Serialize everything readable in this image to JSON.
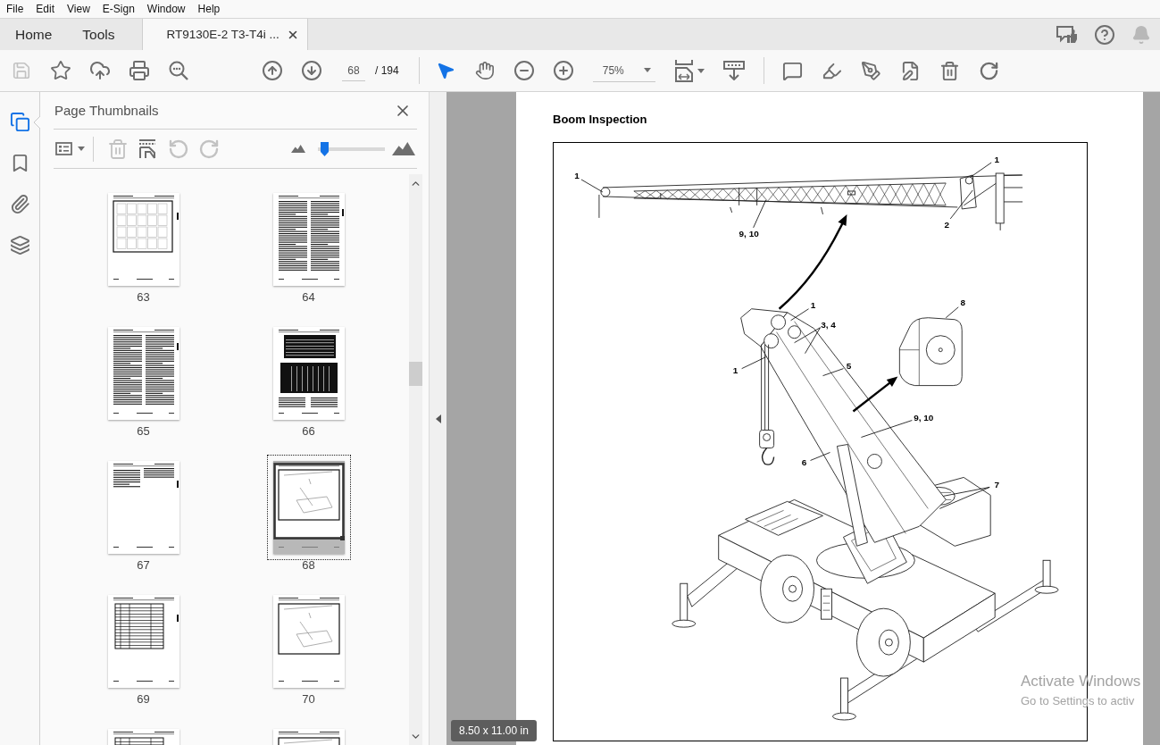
{
  "menu_bar": {
    "items": [
      "File",
      "Edit",
      "View",
      "E-Sign",
      "Window",
      "Help"
    ]
  },
  "tabs": [
    {
      "label": "Home",
      "kind": "home",
      "selected": false
    },
    {
      "label": "Tools",
      "kind": "tools",
      "selected": false
    },
    {
      "label": "RT9130E-2 T3-T4i ...",
      "kind": "document",
      "selected": true
    }
  ],
  "toolbar": {
    "save": {
      "disabled": true
    },
    "page_number": "68",
    "page_count": "/ 194",
    "tools": [
      {
        "kind": "select",
        "selected": true
      },
      {
        "kind": "hand",
        "selected": false
      }
    ],
    "zoom": "75%"
  },
  "sidebar": {
    "nav": [
      {
        "kind": "pages",
        "selected": true
      },
      {
        "kind": "bookmarks",
        "selected": false
      },
      {
        "kind": "attachments",
        "selected": false
      },
      {
        "kind": "layers",
        "selected": false
      }
    ]
  },
  "thumbnails_panel": {
    "title": "Page Thumbnails",
    "tools": [
      {
        "kind": "delete",
        "disabled": true
      },
      {
        "kind": "insert",
        "disabled": false
      },
      {
        "kind": "rotate-ccw",
        "disabled": true
      },
      {
        "kind": "rotate-cw",
        "disabled": true
      }
    ],
    "size_slider": {
      "level": 0.05
    },
    "thumbnails": [
      {
        "label": "63",
        "kind": "figure-grid",
        "selected": false
      },
      {
        "label": "64",
        "kind": "text",
        "selected": false
      },
      {
        "label": "65",
        "kind": "text",
        "selected": false
      },
      {
        "label": "66",
        "kind": "tables",
        "selected": false
      },
      {
        "label": "67",
        "kind": "sparse-text",
        "selected": false
      },
      {
        "label": "68",
        "kind": "figure",
        "selected": true
      },
      {
        "label": "69",
        "kind": "table",
        "selected": false
      },
      {
        "label": "70",
        "kind": "figure",
        "selected": false
      },
      {
        "kind": "table",
        "selected": false
      },
      {
        "kind": "figure",
        "selected": false
      }
    ]
  },
  "document": {
    "page": {
      "title": "Boom Inspection",
      "figure": {
        "callouts": [
          "1",
          "1",
          "2",
          "9, 10",
          "1",
          "3, 4",
          "8",
          "1",
          "5",
          "9, 10",
          "6",
          "7"
        ]
      }
    },
    "page_size": "8.50 x 11.00 in"
  },
  "os_notice": {
    "title": "Activate Windows",
    "subtitle": "Go to Settings to activ"
  }
}
